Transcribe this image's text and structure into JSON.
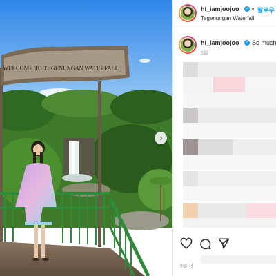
{
  "post": {
    "image_alt": "Tegenungan Waterfall",
    "sign_text": "WELCOME TO TEGENUNGAN WATERFALL",
    "next_icon": "chevron-right-icon"
  },
  "header": {
    "username": "hi_iamjoojoo",
    "verified_mark": "✓",
    "separator": "•",
    "follow_label": "팔로우",
    "location": "Tegenungan Waterfall"
  },
  "caption": {
    "username": "hi_iamjoojoo",
    "verified_mark": "✓",
    "text": "So much",
    "time": "5일"
  },
  "actions": {
    "like_icon": "heart-icon",
    "comment_icon": "comment-icon",
    "share_icon": "share-icon"
  },
  "footer": {
    "date": "5일 전"
  },
  "colors": {
    "follow": "#0095f6",
    "verified": "#1d9bf0",
    "muted": "#8e8e8e"
  }
}
